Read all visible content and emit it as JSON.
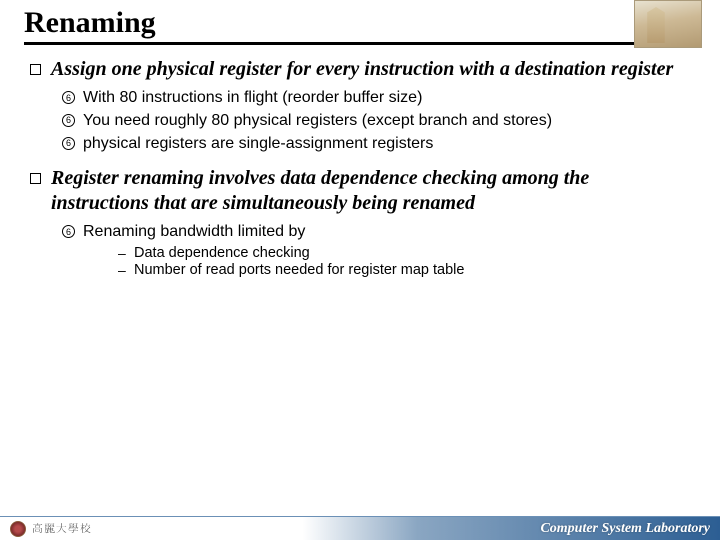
{
  "header": {
    "title": "Renaming"
  },
  "points": [
    {
      "text": "Assign one physical register for every instruction with a destination register",
      "subs": [
        {
          "text": "With 80 instructions in flight (reorder buffer size)"
        },
        {
          "text": "You need roughly 80 physical registers (except branch and stores)"
        },
        {
          "text": "physical registers are single-assignment registers"
        }
      ]
    },
    {
      "text": "Register renaming involves data dependence checking among the instructions that are simultaneously being renamed",
      "subs": [
        {
          "text": "Renaming bandwidth limited by",
          "subs": [
            {
              "text": "Data dependence checking"
            },
            {
              "text": "Number of read ports needed for register map table"
            }
          ]
        }
      ]
    }
  ],
  "footer": {
    "left": "高麗大學校",
    "right": "Computer System Laboratory"
  }
}
